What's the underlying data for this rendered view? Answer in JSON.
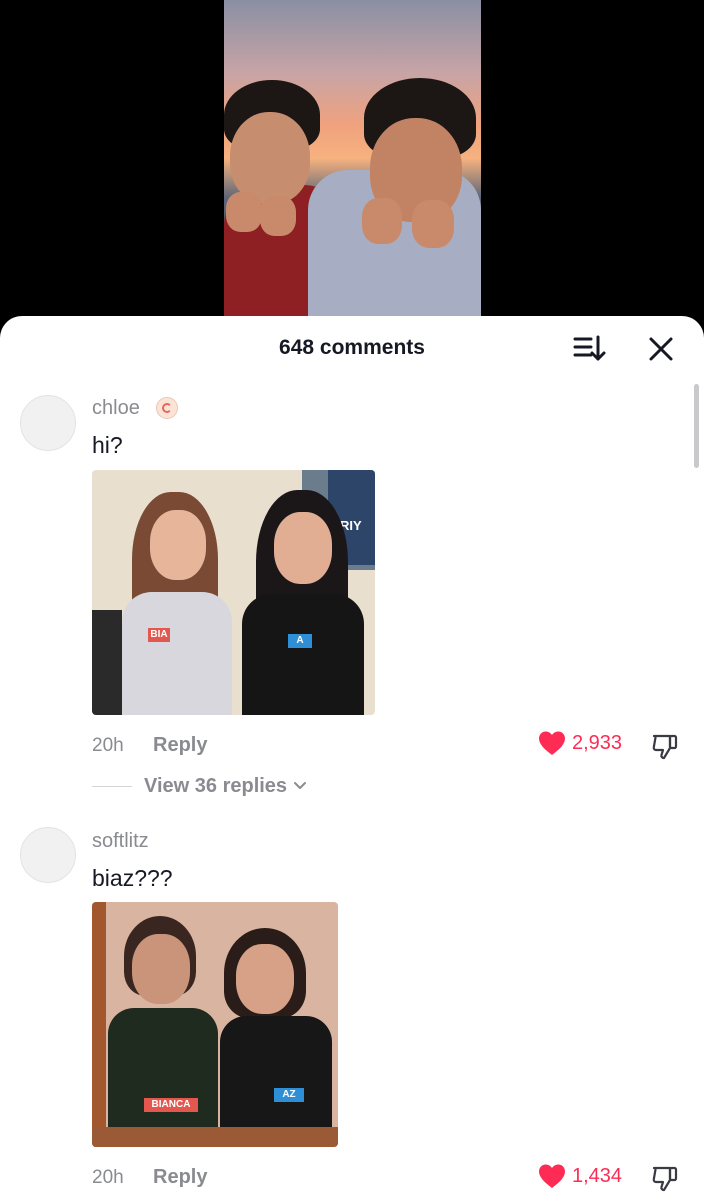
{
  "sheet": {
    "comment_count": "648 comments"
  },
  "icons": {
    "sort": "sort-icon",
    "close": "close-icon",
    "heart": "heart-icon",
    "dislike": "thumbs-down-icon",
    "chevron": "chevron-down-icon"
  },
  "colors": {
    "like_red": "#fe2c55",
    "muted_text": "#8a8b91",
    "text": "#161823"
  },
  "comments": [
    {
      "username": "chloe",
      "text": "hi?",
      "time": "20h",
      "reply_label": "Reply",
      "likes": "2,933",
      "view_replies": "View 36 replies",
      "photo_tags": [
        "BIA",
        "A"
      ],
      "photo_poster_text": "RIY"
    },
    {
      "username": "softlitz",
      "text": "biaz???",
      "time": "20h",
      "reply_label": "Reply",
      "likes": "1,434",
      "photo_tags": [
        "BIANCA",
        "AZ"
      ]
    }
  ]
}
